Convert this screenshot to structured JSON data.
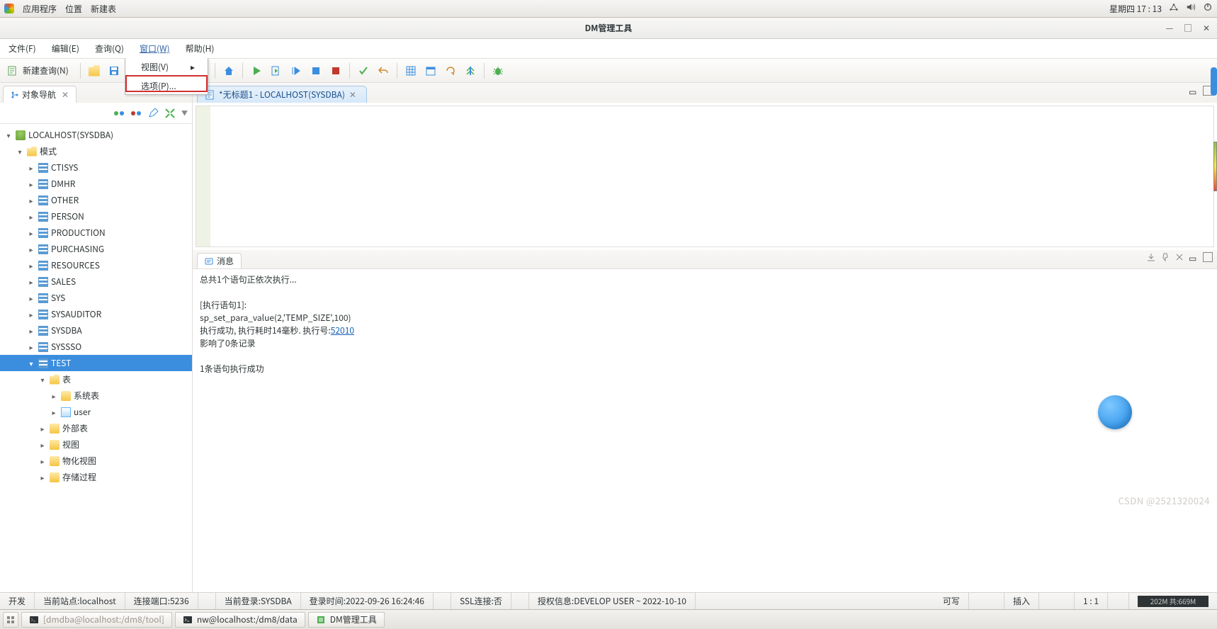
{
  "os": {
    "apps": "应用程序",
    "places": "位置",
    "newTable": "新建表",
    "clock": "星期四 17 : 13"
  },
  "window": {
    "title": "DM管理工具"
  },
  "menu": {
    "file": "文件(F)",
    "edit": "编辑(E)",
    "query": "查询(Q)",
    "window": "窗口(W)",
    "help": "帮助(H)"
  },
  "dropdown": {
    "view": "视图(V)",
    "options": "选项(P)..."
  },
  "toolbar": {
    "newQuery": "新建查询(N)"
  },
  "leftPanel": {
    "title": "对象导航",
    "root": "LOCALHOST(SYSDBA)",
    "schemas": "模式",
    "items": [
      "CTISYS",
      "DMHR",
      "OTHER",
      "PERSON",
      "PRODUCTION",
      "PURCHASING",
      "RESOURCES",
      "SALES",
      "SYS",
      "SYSAUDITOR",
      "SYSDBA",
      "SYSSSO"
    ],
    "test": "TEST",
    "tables": "表",
    "sysTables": "系统表",
    "userTable": "user",
    "extTables": "外部表",
    "views": "视图",
    "matViews": "物化视图",
    "procs": "存储过程"
  },
  "editor": {
    "tabTitle": "*无标题1 - LOCALHOST(SYSDBA)"
  },
  "messages": {
    "tab": "消息",
    "line1": "总共1个语句正依次执行...",
    "line2": "[执行语句1]:",
    "line3": "sp_set_para_value(2,'TEMP_SIZE',100)",
    "line4a": "执行成功, 执行耗时14毫秒. 执行号:",
    "line4link": "52010",
    "line5": "影响了0条记录",
    "line6": "1条语句执行成功"
  },
  "status": {
    "dev": "开发",
    "site": "当前站点:localhost",
    "port": "连接端口:5236",
    "login": "当前登录:SYSDBA",
    "loginTime": "登录时间:2022-09-26 16:24:46",
    "ssl": "SSL连接:否",
    "auth": "授权信息:DEVELOP USER ~ 2022-10-10",
    "rw": "可写",
    "ins": "插入",
    "pos": "1 : 1",
    "mem": "202M 共:669M"
  },
  "taskbar": {
    "t1": "[dmdba@localhost:/dm8/tool]",
    "t2": "nw@localhost:/dm8/data",
    "t3": "DM管理工具"
  },
  "watermark": "CSDN @2521320024"
}
